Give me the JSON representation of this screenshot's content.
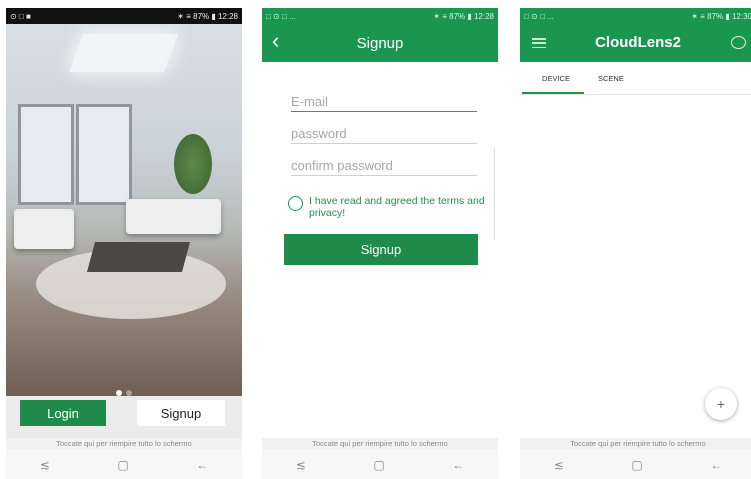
{
  "status_bar": {
    "phone1": {
      "left": "⊙ □ ■",
      "right": "✶ ≡ 87% ▮ 12:28"
    },
    "phone2": {
      "left": "□ ⊙ □ ...",
      "right": "✶ ≡ 87% ▮ 12:28"
    },
    "phone3": {
      "left": "□ ⊙ □ ...",
      "right": "✶ ≡ 87% ▮ 12:30"
    }
  },
  "welcome": {
    "login_label": "Login",
    "signup_label": "Signup"
  },
  "signup": {
    "title": "Signup",
    "email_placeholder": "E-mail",
    "password_placeholder": "password",
    "confirm_placeholder": "confirm password",
    "agree_text": "I have read and agreed the terms and privacy!",
    "signup_button": "Signup"
  },
  "device_list": {
    "app_title": "CloudLens2",
    "tabs": [
      {
        "label": "DEVICE"
      },
      {
        "label": "SCENE"
      }
    ],
    "add_label": "+"
  },
  "system": {
    "fullscreen_hint": "Toccate qui per riempire tutto lo schermo",
    "nav_recent": "≲",
    "nav_home": "▢",
    "nav_back": "←"
  },
  "colors": {
    "brand_green": "#1a9650",
    "button_green": "#1f8a4a"
  }
}
